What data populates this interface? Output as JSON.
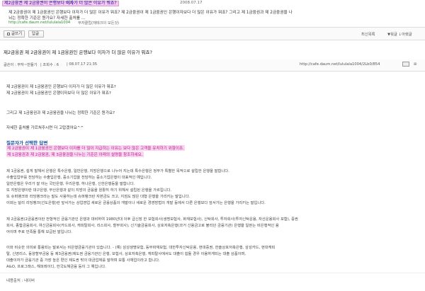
{
  "result": {
    "title_pre": "제2금융권 제 2금융권이 은행보다 ",
    "title_hl": "이자",
    "title_post": "가 더 많은 이유가 뭐죠?",
    "date": "2008.07.17",
    "snippet1": "제 2금융권이 제 1금융권인 은행보다 이자가 더 많은 이유가 뭐죠? 제 2금융권이 제 1금융권인 은행이자보다 더 많은 이유가 뭐죠? 그리고 제 1금융권과 제 2금융권을 나",
    "snippet2": "뉘는 정확한 기준은 뭔가요? 자세한 출처를 ...",
    "url": "http://cafe.daum.net/lululala1004",
    "source": "부자클럽(재테크의 모든것)"
  },
  "toolbar": {
    "list_label": "글쓰기",
    "reply_label": "답글",
    "latest_label": "최신목록",
    "up_icon": "▲",
    "oldest_label": "▼윗글 ↓아랫글",
    "down_icon": ""
  },
  "post": {
    "title": "제2금융권 제 2금융권이 제 1금융권인 은행보다 이자가 더 많은 이유가 뭐죠?",
    "author": "글쓴이 : 부자~만들기",
    "views": "| 조회수 : 6",
    "date": "| 08.07.17 21:35",
    "url": "http://cafe.daum.net/lululala1004/2Lb0/854",
    "scroll": "⊠"
  },
  "body": {
    "lines": [
      "제 2금융권이 제 1금융권인 은행보다 이자가 더 많은 이유가 뭐죠?",
      "제 2금융권이 제 1금융권인 은행이자보다 더 많은 이유가 뭐죠?",
      "",
      "그리고 제 1금융권과 제 2금융권을 나뉘는 정확한 기준은 뭔가요?",
      "",
      "자세한 출처를 가르쳐주시면 더 고맙겠어요^^"
    ]
  },
  "answer": {
    "title": "질문자가 선택한 답변",
    "hl1": "제 2금융권이 제 1금융권인 은행보다 이자를 더 많이 지급하는 이유는 보다 많은 고객을 유치하기 위함이죠.",
    "hl2": "제 1금융권과 제 2금융권, 제 3금융권을 나누는 기준은 아래의 설명을 참조하세요.",
    "lines": [
      "제 1금융권, 쉽게 말해서 은행은 특수은행, 일반은행, 지방은행으로 나누어 지는데 특수은행은 정부가 특별한 목적으로 설립한 은행을 말합니다.",
      "수출입업무를 전담하는 수출입은행, 중소기업을 전담하는 중소기업은행이 대표적인 예입니다.",
      "일반은행은 우리가 잘 아는 국민은행, 우리은행, 하나은행, 신한은행등을 말합니다.",
      "또 지방은행이란 대구은행, 부산은행과 같이 지방의 금융을 원활히 하기 위해서 설립된 은행을 가르킵니다.",
      "또 슈퍼뱅크와 라딩뱅크라는 말도 사용하는데 슈퍼뱅크란 자본금도 크고, 지점도 많은 대형 은행을 가리키는 말입니다.",
      "이와는 달리 리딩뱅크(선도은행)란 앞서가는 상업영업 새로운 금융상품의 개발이나 새로운 경영방법의 개발 등에서 다른 은행보다 앞서가는 은행을 가리키는 말입니다.",
      "",
      "제 2금융권(2금융권이란 전형적인 금융기관인 은행과 대비하여 1980년대 이후 급신장 한 보험회사(생명보험사, 화재보험사), 신탁회사, 투자회사(투자신탁운용, 자산운용회사 포함), 증권",
      "회사, 종합금융회사, 여신금융회사(카드회사, 캐피탈회사, 리스회사, 할부회사), 신기술금융회사, 상호저축은행(과거 신용금고로 불리던 금융기관) 은행을 일컫는 비은행적인 용",
      "어이며 주로 민족들 통해 보급된 말입니다.",
      "",
      "이와 비슷한 의미로 통용되는 말로서는 비은행금융기관이 있습니다. - (예) 삼성생명보험, 동부화재보험, 대한투자신탁운용, 현대증권, 한솔상호저축은행, 삼성카드, 현대캐피",
      "탈, 신영리스, 동양할부금융 등 제3금융권(제도권 금융기관인 은행, 보험사, 상호저축은행, 캐피탈사에서도 대출이 힘들 경우 이용하게되는 대출 상품이며,",
      "대출이자가 금융기관 중 가장 높은 편인 제도권 밖의 대금업체를 말하며 보통 사채업이라고 합니다.",
      "A&O, 프로그래스, 해피레이디, 한국도해금융 등이 그 예입니다."
    ],
    "source": "내용출처 : 네이버"
  }
}
